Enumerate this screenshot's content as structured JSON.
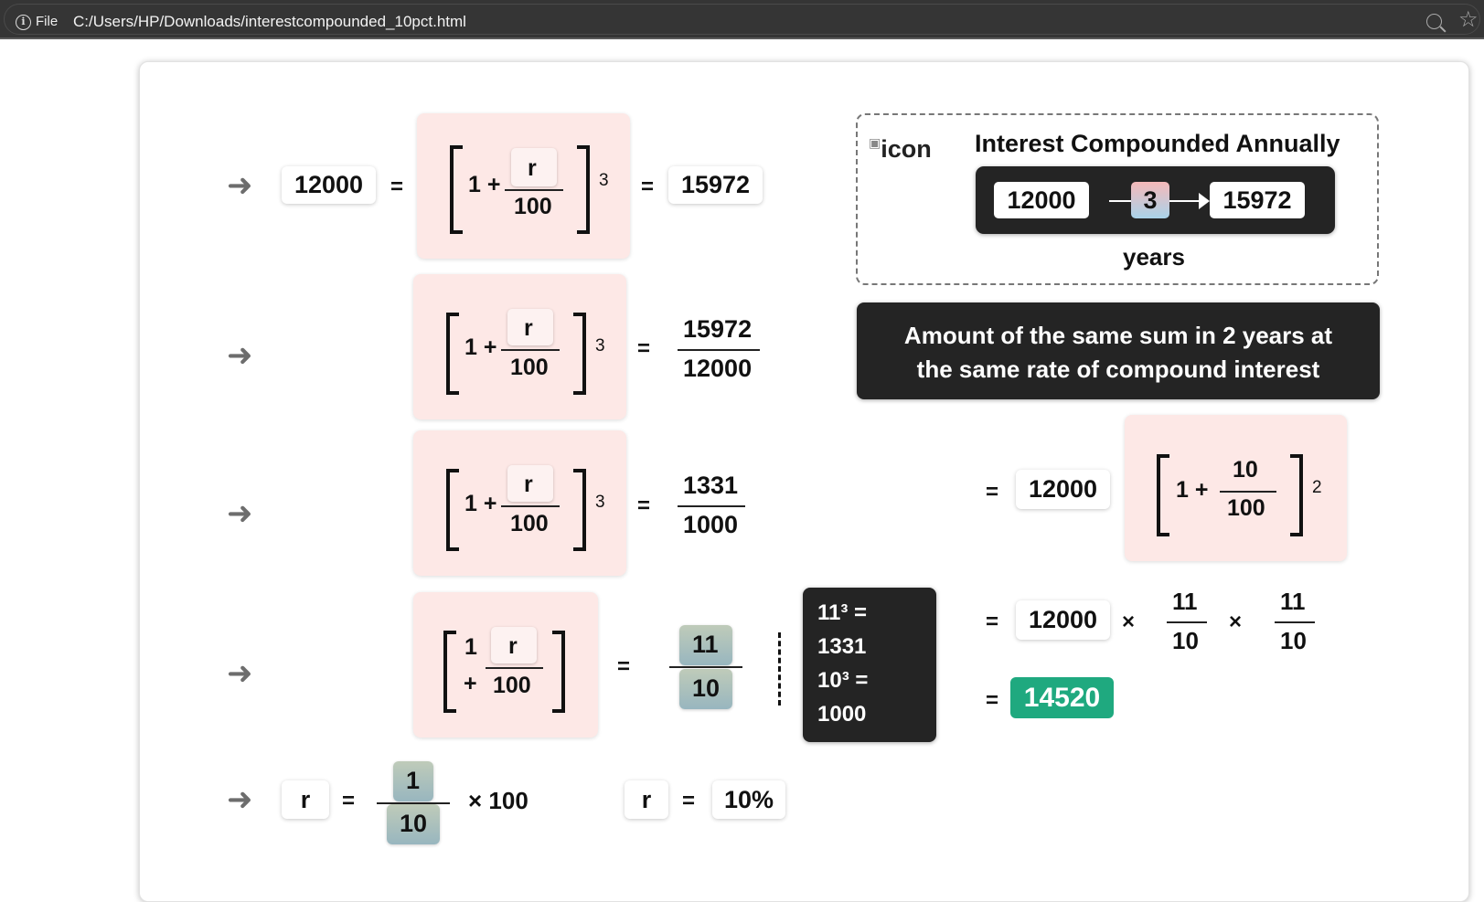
{
  "browser": {
    "file_label": "File",
    "url": "C:/Users/HP/Downloads/interestcompounded_10pct.html"
  },
  "arrow_glyph": "➜",
  "principal": "12000",
  "amount_3yr": "15972",
  "formula": {
    "one": "1",
    "plus": "+",
    "rate_var": "r",
    "hundred": "100",
    "equals": "=",
    "exp_3": "3",
    "exp_2": "2",
    "times": "×"
  },
  "step2": {
    "numerator": "15972",
    "denominator": "12000"
  },
  "step3": {
    "numerator": "1331",
    "denominator": "1000"
  },
  "step4": {
    "numerator": "11",
    "denominator": "10"
  },
  "cube_note": {
    "line1": "11³ =",
    "line2": "1331",
    "line3": "10³ =",
    "line4": "1000"
  },
  "step5": {
    "numerator": "1",
    "denominator": "10",
    "times_100": "× 100",
    "r_label": "r",
    "r_value": "10%"
  },
  "info_box": {
    "img_alt": "icon",
    "title": "Interest Compounded Annually",
    "from": "12000",
    "years_value": "3",
    "to": "15972",
    "years_label": "years"
  },
  "question": "Amount of the same sum in 2 years at the same rate of compound interest",
  "answer": {
    "principal": "12000",
    "frac_num": "10",
    "frac_den": "100",
    "mult_num": "11",
    "mult_den": "10",
    "result": "14520",
    "result_color": "#1fa97f"
  }
}
